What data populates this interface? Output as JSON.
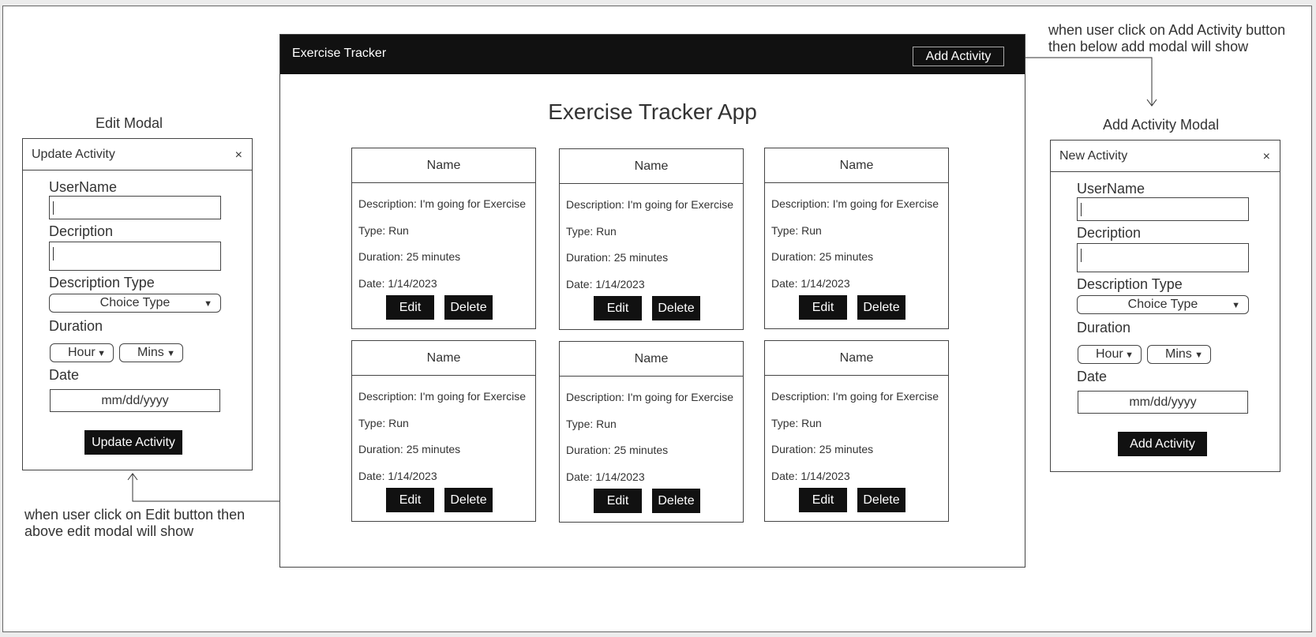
{
  "app": {
    "brand": "Exercise Tracker",
    "add_button": "Add Activity",
    "title": "Exercise Tracker App"
  },
  "cards": [
    {
      "name": "Name",
      "description": "Description: I'm going for Exercise",
      "type": "Type: Run",
      "duration": "Duration: 25 minutes",
      "date": "Date: 1/14/2023",
      "edit": "Edit",
      "delete": "Delete"
    },
    {
      "name": "Name",
      "description": "Description: I'm going for Exercise",
      "type": "Type: Run",
      "duration": "Duration: 25 minutes",
      "date": "Date: 1/14/2023",
      "edit": "Edit",
      "delete": "Delete"
    },
    {
      "name": "Name",
      "description": "Description: I'm going for Exercise",
      "type": "Type: Run",
      "duration": "Duration: 25 minutes",
      "date": "Date: 1/14/2023",
      "edit": "Edit",
      "delete": "Delete"
    },
    {
      "name": "Name",
      "description": "Description: I'm going for Exercise",
      "type": "Type: Run",
      "duration": "Duration: 25 minutes",
      "date": "Date: 1/14/2023",
      "edit": "Edit",
      "delete": "Delete"
    },
    {
      "name": "Name",
      "description": "Description: I'm going for Exercise",
      "type": "Type: Run",
      "duration": "Duration: 25 minutes",
      "date": "Date: 1/14/2023",
      "edit": "Edit",
      "delete": "Delete"
    },
    {
      "name": "Name",
      "description": "Description: I'm going for Exercise",
      "type": "Type: Run",
      "duration": "Duration: 25 minutes",
      "date": "Date: 1/14/2023",
      "edit": "Edit",
      "delete": "Delete"
    }
  ],
  "edit_modal": {
    "section_label": "Edit Modal",
    "title": "Update Activity",
    "close": "×",
    "username_label": "UserName",
    "username_value": "",
    "description_label": "Decription",
    "description_value": "",
    "type_label": "Description Type",
    "type_value": "Choice Type",
    "duration_label": "Duration",
    "hour": "Hour",
    "mins": "Mins",
    "date_label": "Date",
    "date_placeholder": "mm/dd/yyyy",
    "submit": "Update Activity"
  },
  "add_modal": {
    "section_label": "Add Activity Modal",
    "title": "New Activity",
    "close": "×",
    "username_label": "UserName",
    "username_value": "",
    "description_label": "Decription",
    "description_value": "",
    "type_label": "Description Type",
    "type_value": "Choice Type",
    "duration_label": "Duration",
    "hour": "Hour",
    "mins": "Mins",
    "date_label": "Date",
    "date_placeholder": "mm/dd/yyyy",
    "submit": "Add Activity"
  },
  "annotations": {
    "add_note_line1": "when user click on Add Activity button",
    "add_note_line2": "then below add modal will show",
    "edit_note_line1": "when user click on Edit button then",
    "edit_note_line2": "above edit modal will show"
  },
  "icons": {
    "dropdown": "chevron-down-icon",
    "close": "close-icon",
    "arrow": "arrow-icon"
  },
  "colors": {
    "navbar": "#111111",
    "button": "#111111",
    "border": "#444444"
  }
}
